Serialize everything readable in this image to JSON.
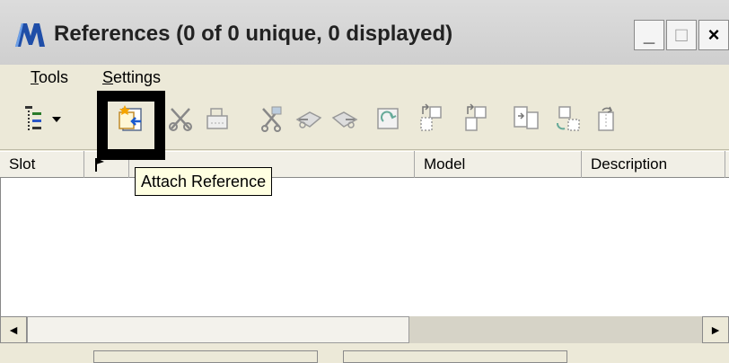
{
  "window": {
    "title": "References (0 of 0 unique, 0 displayed)",
    "minimize": "_",
    "maximize": "□",
    "close": "×"
  },
  "menu": {
    "tools": {
      "accel": "T",
      "rest": "ools"
    },
    "settings": {
      "accel": "S",
      "rest": "ettings"
    }
  },
  "toolbar": {
    "icons": [
      "hierarchy-dropdown-icon",
      "attach-reference-icon",
      "detach-reference-icon",
      "reload-reference-icon",
      "clip-boundary-icon",
      "clip-mask-icon",
      "delete-clip-icon",
      "exchange-icon",
      "move-icon",
      "copy-icon",
      "scale-icon",
      "rotate-icon",
      "mirror-icon"
    ]
  },
  "tooltip": {
    "text": "Attach Reference"
  },
  "table": {
    "columns": [
      "Slot",
      "",
      "",
      "Model",
      "Description"
    ],
    "rows": []
  },
  "scroll": {
    "left": "◄",
    "right": "►"
  },
  "colors": {
    "window_bg": "#ece9d8",
    "tooltip_bg": "#ffffe1",
    "highlight": "#000000",
    "app_icon": "#1f4ea8"
  }
}
